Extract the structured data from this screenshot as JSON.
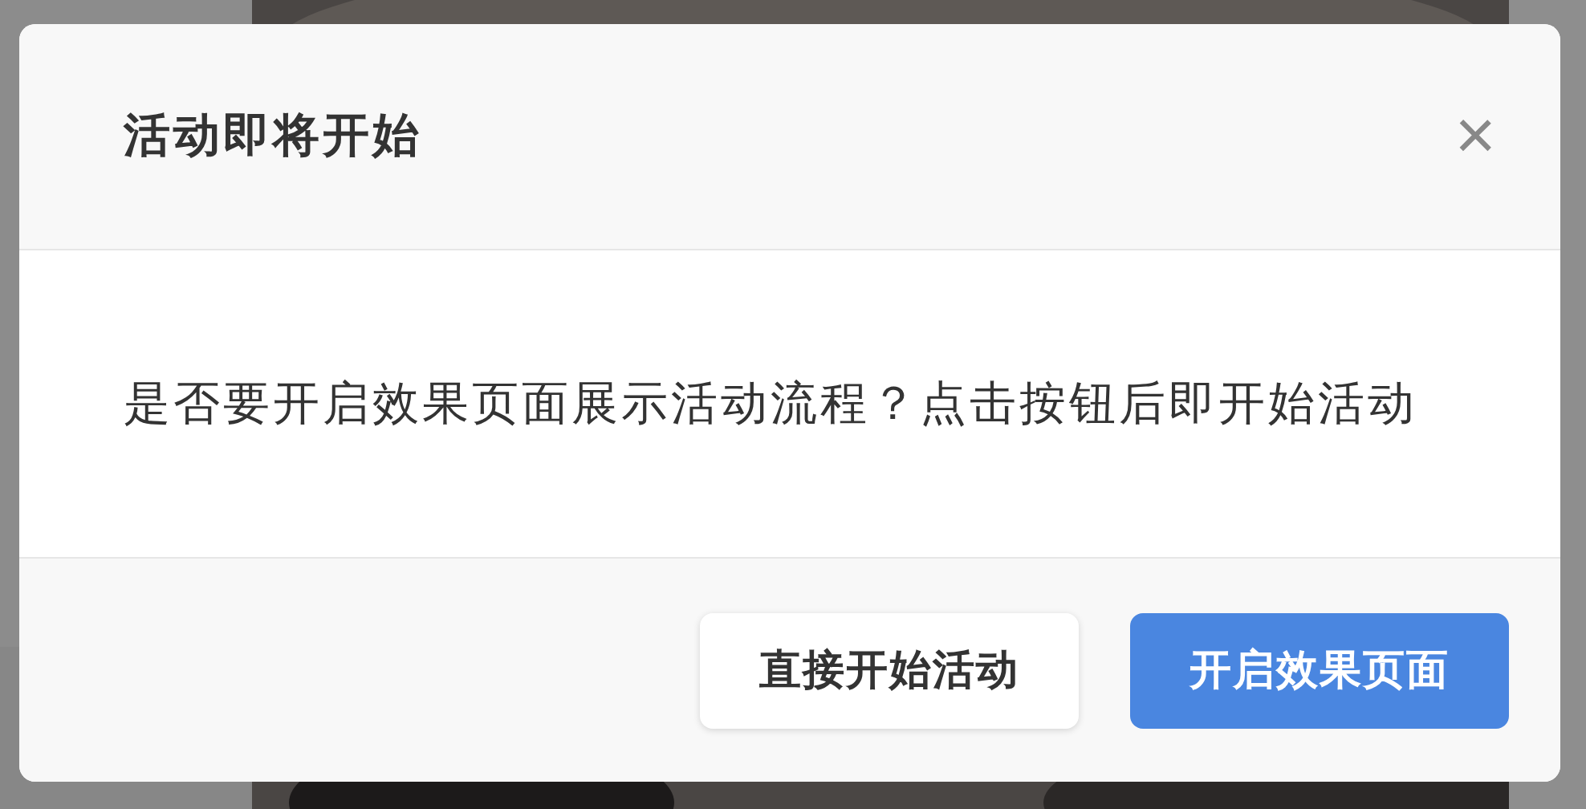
{
  "dialog": {
    "title": "活动即将开始",
    "close": "×",
    "message": "是否要开启效果页面展示活动流程？点击按钮后即开始活动",
    "buttons": [
      {
        "label": "直接开始活动",
        "kind": "secondary"
      },
      {
        "label": "开启效果页面",
        "kind": "primary"
      }
    ]
  }
}
